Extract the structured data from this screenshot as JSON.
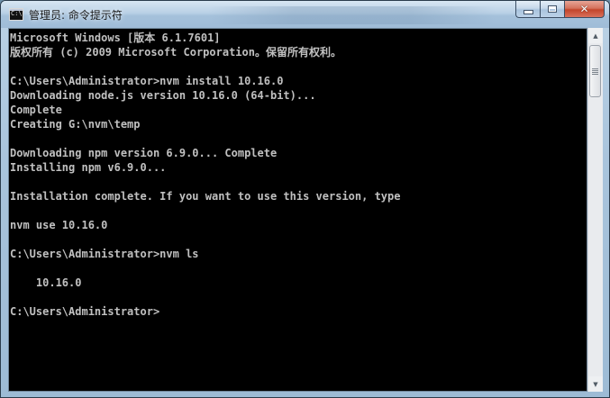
{
  "window": {
    "title": "管理员: 命令提示符",
    "icon": "console-app-icon",
    "icon_label": "C:\\"
  },
  "controls": {
    "minimize_icon": "minimize-icon",
    "maximize_icon": "maximize-icon",
    "close_icon": "close-icon",
    "close_glyph": "✕"
  },
  "console": {
    "lines": [
      "Microsoft Windows [版本 6.1.7601]",
      "版权所有 (c) 2009 Microsoft Corporation。保留所有权利。",
      "",
      "C:\\Users\\Administrator>nvm install 10.16.0",
      "Downloading node.js version 10.16.0 (64-bit)...",
      "Complete",
      "Creating G:\\nvm\\temp",
      "",
      "Downloading npm version 6.9.0... Complete",
      "Installing npm v6.9.0...",
      "",
      "Installation complete. If you want to use this version, type",
      "",
      "nvm use 10.16.0",
      "",
      "C:\\Users\\Administrator>nvm ls",
      "",
      "    10.16.0",
      "",
      "C:\\Users\\Administrator>"
    ]
  },
  "scrollbar": {
    "up_glyph": "▲",
    "down_glyph": "▼"
  }
}
